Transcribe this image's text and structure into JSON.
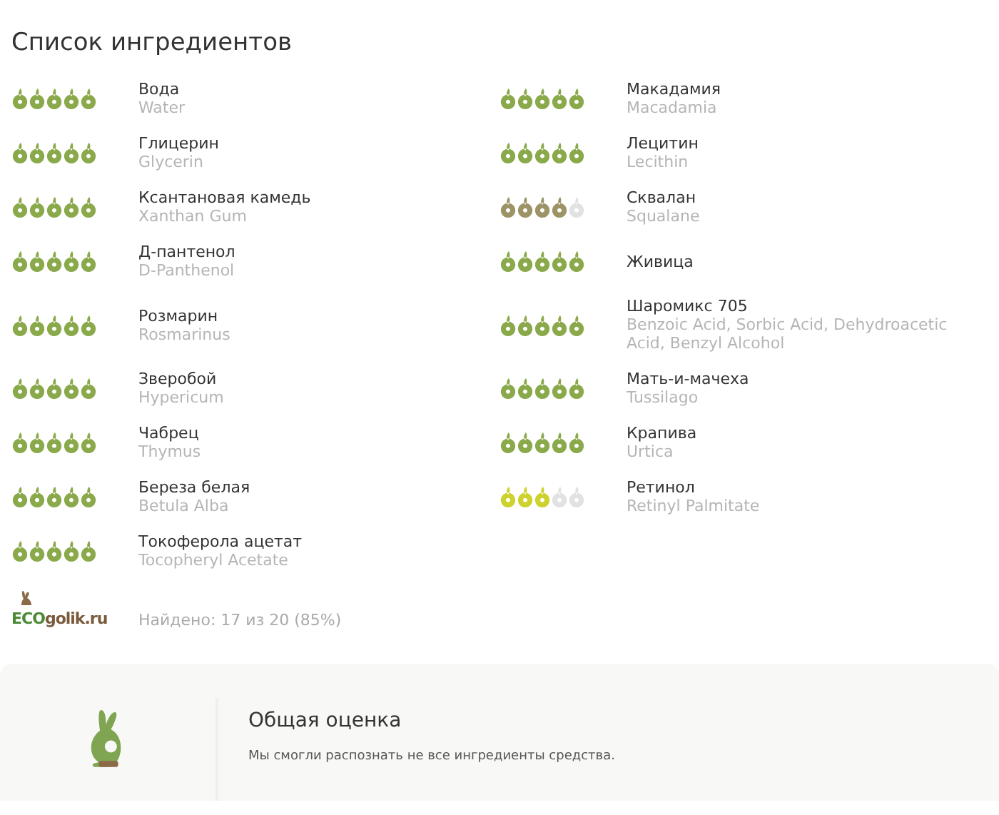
{
  "title": "Список ингредиентов",
  "ingredients": [
    {
      "name": "Вода",
      "inci": "Water",
      "stars": 5,
      "color": "#8aa94a"
    },
    {
      "name": "Глицерин",
      "inci": "Glycerin",
      "stars": 5,
      "color": "#8aa94a"
    },
    {
      "name": "Ксантановая камедь",
      "inci": "Xanthan Gum",
      "stars": 5,
      "color": "#8aa94a"
    },
    {
      "name": "Д-пантенол",
      "inci": "D-Panthenol",
      "stars": 5,
      "color": "#8aa94a"
    },
    {
      "name": "Розмарин",
      "inci": "Rosmarinus",
      "stars": 5,
      "color": "#8aa94a"
    },
    {
      "name": "Зверобой",
      "inci": "Hypericum",
      "stars": 5,
      "color": "#8aa94a"
    },
    {
      "name": "Чабрец",
      "inci": "Thymus",
      "stars": 5,
      "color": "#8aa94a"
    },
    {
      "name": "Береза белая",
      "inci": "Betula Alba",
      "stars": 5,
      "color": "#8aa94a"
    },
    {
      "name": "Токоферола ацетат",
      "inci": "Tocopheryl Acetate",
      "stars": 5,
      "color": "#8aa94a"
    },
    {
      "name": "Макадамия",
      "inci": "Macadamia",
      "stars": 5,
      "color": "#8aa94a"
    },
    {
      "name": "Лецитин",
      "inci": "Lecithin",
      "stars": 5,
      "color": "#8aa94a"
    },
    {
      "name": "Сквалан",
      "inci": "Squalane",
      "stars": 4,
      "color": "#9c9466"
    },
    {
      "name": "Живица",
      "stars": 5,
      "color": "#8aa94a"
    },
    {
      "name": "Шаромикс 705",
      "inci": "Benzoic Acid, Sorbic Acid, Dehydroacetic Acid, Benzyl Alcohol",
      "stars": 5,
      "color": "#8aa94a"
    },
    {
      "name": "Мать-и-мачеха",
      "inci": "Tussilago",
      "stars": 5,
      "color": "#8aa94a"
    },
    {
      "name": "Крапива",
      "inci": "Urtica",
      "stars": 5,
      "color": "#8aa94a"
    },
    {
      "name": "Ретинол",
      "inci": "Retinyl Palmitate",
      "stars": 3,
      "color": "#cdd22e"
    }
  ],
  "logo": {
    "eco": "ECO",
    "rest": "golik.ru"
  },
  "found": "Найдено: 17 из 20 (85%)",
  "summary": {
    "title": "Общая оценка",
    "text": "Мы смогли распознать не все ингредиенты средства."
  }
}
